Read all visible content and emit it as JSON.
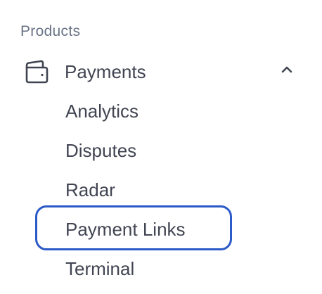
{
  "sidebar": {
    "section_label": "Products",
    "parent": {
      "label": "Payments",
      "icon": "wallet-icon",
      "expanded_icon": "chevron-up-icon"
    },
    "items": [
      {
        "label": "Analytics"
      },
      {
        "label": "Disputes"
      },
      {
        "label": "Radar"
      },
      {
        "label": "Payment Links",
        "highlighted": true
      },
      {
        "label": "Terminal"
      }
    ]
  },
  "colors": {
    "text": "#414552",
    "section_label": "#697386",
    "highlight_ring": "#2c5ac8"
  }
}
